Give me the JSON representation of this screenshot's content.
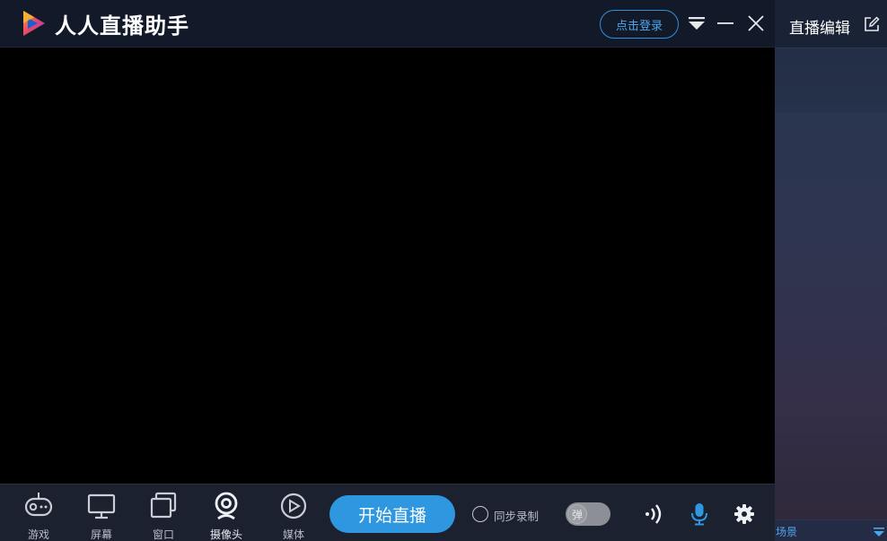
{
  "app": {
    "title": "人人直播助手",
    "login_label": "点击登录"
  },
  "toolbar": {
    "tools": [
      {
        "label": "游戏",
        "icon": "gamepad-icon"
      },
      {
        "label": "屏幕",
        "icon": "monitor-icon"
      },
      {
        "label": "窗口",
        "icon": "window-icon"
      },
      {
        "label": "摄像头",
        "icon": "webcam-icon"
      },
      {
        "label": "媒体",
        "icon": "play-media-icon"
      }
    ],
    "start_label": "开始直播",
    "sync_record_label": "同步录制",
    "danmaku_toggle_label": "弹"
  },
  "right_panel": {
    "title": "直播编辑",
    "scene_label": "场景"
  },
  "colors": {
    "accent": "#2e97e0",
    "titlebar_bg": "#121a2a",
    "toolbar_bg": "#1c2130"
  }
}
